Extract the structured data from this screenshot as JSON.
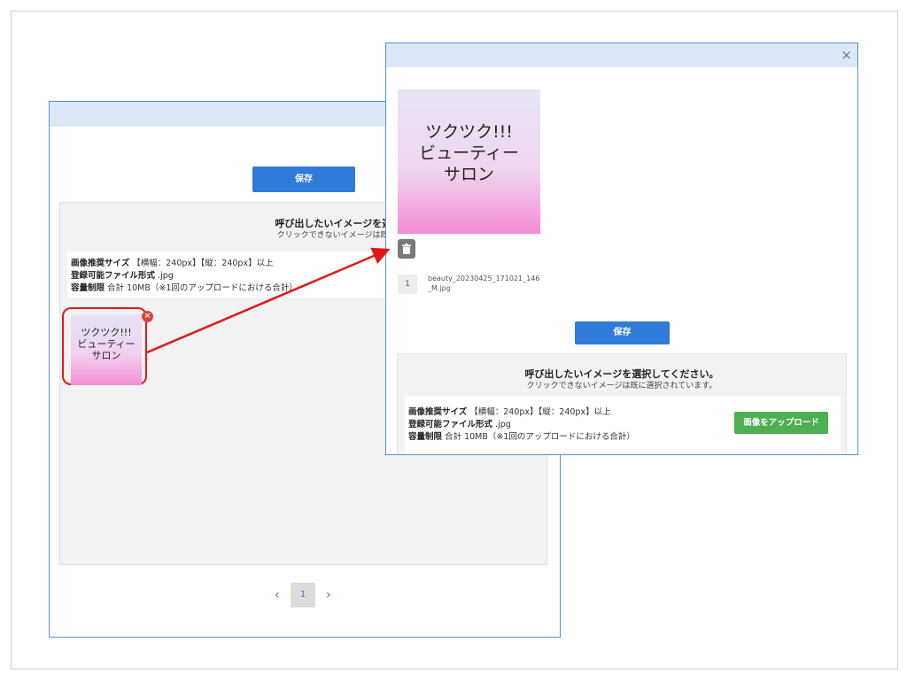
{
  "back_window": {
    "save_label": "保存",
    "panel": {
      "title": "呼び出したいイメージを選択してください。",
      "subtitle": "クリックできないイメージは既に選択されています。",
      "info": {
        "size_label": "画像推奨サイズ",
        "size_value": "【横幅：240px】【縦：240px】以上",
        "format_label": "登録可能ファイル形式",
        "format_value": ".jpg",
        "limit_label": "容量制限",
        "limit_value": "合計 10MB（※1回のアップロードにおける合計）"
      },
      "thumbnail": {
        "line1": "ツクツク!!!",
        "line2": "ビューティー",
        "line3": "サロン",
        "remove_glyph": "×"
      }
    },
    "pager": {
      "prev": "‹",
      "current": "1",
      "next": "›"
    }
  },
  "front_window": {
    "close_glyph": "×",
    "image": {
      "line1": "ツクツク!!!",
      "line2": "ビューティー",
      "line3": "サロン"
    },
    "file": {
      "index": "1",
      "name": "beauty_20230425_171021_146_M.jpg"
    },
    "save_label": "保存",
    "panel": {
      "title": "呼び出したいイメージを選択してください。",
      "subtitle": "クリックできないイメージは既に選択されています。",
      "info": {
        "size_label": "画像推奨サイズ",
        "size_value": "【横幅：240px】【縦：240px】以上",
        "format_label": "登録可能ファイル形式",
        "format_value": ".jpg",
        "limit_label": "容量制限",
        "limit_value": "合計 10MB（※1回のアップロードにおける合計）"
      },
      "upload_label": "画像をアップロード"
    }
  },
  "colors": {
    "accent_blue": "#2f7bd8",
    "upload_green": "#4caf50",
    "highlight_red": "#e01818",
    "titlebar": "#dce8f7"
  }
}
